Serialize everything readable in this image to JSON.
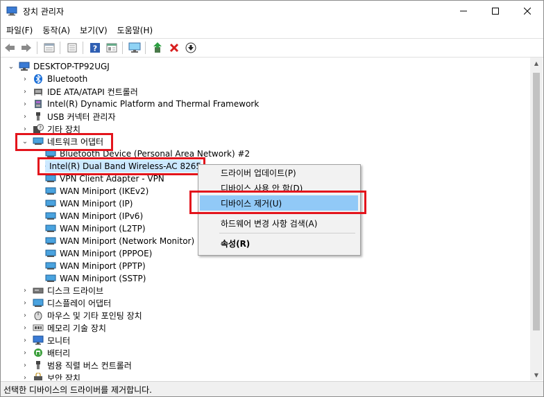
{
  "window": {
    "title": "장치 관리자"
  },
  "menu": [
    "파일(F)",
    "동작(A)",
    "보기(V)",
    "도움말(H)"
  ],
  "toolbar": [
    "back-icon",
    "forward-icon",
    "properties-icon",
    "update-icon",
    "help-icon",
    "view-icon",
    "monitor-icon",
    "enable-icon",
    "uninstall-icon",
    "scan-icon"
  ],
  "tree": {
    "root": "DESKTOP-TP92UGJ",
    "items_before": [
      {
        "label": "Bluetooth",
        "icon": "bluetooth-icon"
      },
      {
        "label": "IDE ATA/ATAPI 컨트롤러",
        "icon": "ide-controller-icon"
      },
      {
        "label": "Intel(R) Dynamic Platform and Thermal Framework",
        "icon": "thermal-icon"
      },
      {
        "label": "USB 커넥터 관리자",
        "icon": "usb-icon"
      },
      {
        "label": "기타 장치",
        "icon": "unknown-device-icon"
      }
    ],
    "network_category": "네트워크 어댑터",
    "network_children": [
      "Bluetooth Device (Personal Area Network) #2",
      "Intel(R) Dual Band Wireless-AC 8265",
      "VPN Client Adapter - VPN",
      "WAN Miniport (IKEv2)",
      "WAN Miniport (IP)",
      "WAN Miniport (IPv6)",
      "WAN Miniport (L2TP)",
      "WAN Miniport (Network Monitor)",
      "WAN Miniport (PPPOE)",
      "WAN Miniport (PPTP)",
      "WAN Miniport (SSTP)"
    ],
    "items_after": [
      {
        "label": "디스크 드라이브",
        "icon": "disk-drive-icon"
      },
      {
        "label": "디스플레이 어댑터",
        "icon": "display-adapter-icon"
      },
      {
        "label": "마우스 및 기타 포인팅 장치",
        "icon": "mouse-icon"
      },
      {
        "label": "메모리 기술 장치",
        "icon": "memory-icon"
      },
      {
        "label": "모니터",
        "icon": "monitor-icon"
      },
      {
        "label": "배터리",
        "icon": "battery-icon"
      },
      {
        "label": "범용 직렬 버스 컨트롤러",
        "icon": "usb-controller-icon"
      },
      {
        "label": "보안 장치",
        "icon": "security-device-icon"
      }
    ]
  },
  "context_menu": {
    "update_driver": "드라이버 업데이트(P)",
    "disable_device": "디바이스 사용 안 함(D)",
    "uninstall_device": "디바이스 제거(U)",
    "scan_changes": "하드웨어 변경 사항 검색(A)",
    "properties": "속성(R)"
  },
  "status": "선택한 디바이스의 드라이버를 제거합니다.",
  "colors": {
    "highlight": "#cce8ff",
    "menu_highlight": "#91c9f7",
    "annotation_red": "#e3141c"
  }
}
